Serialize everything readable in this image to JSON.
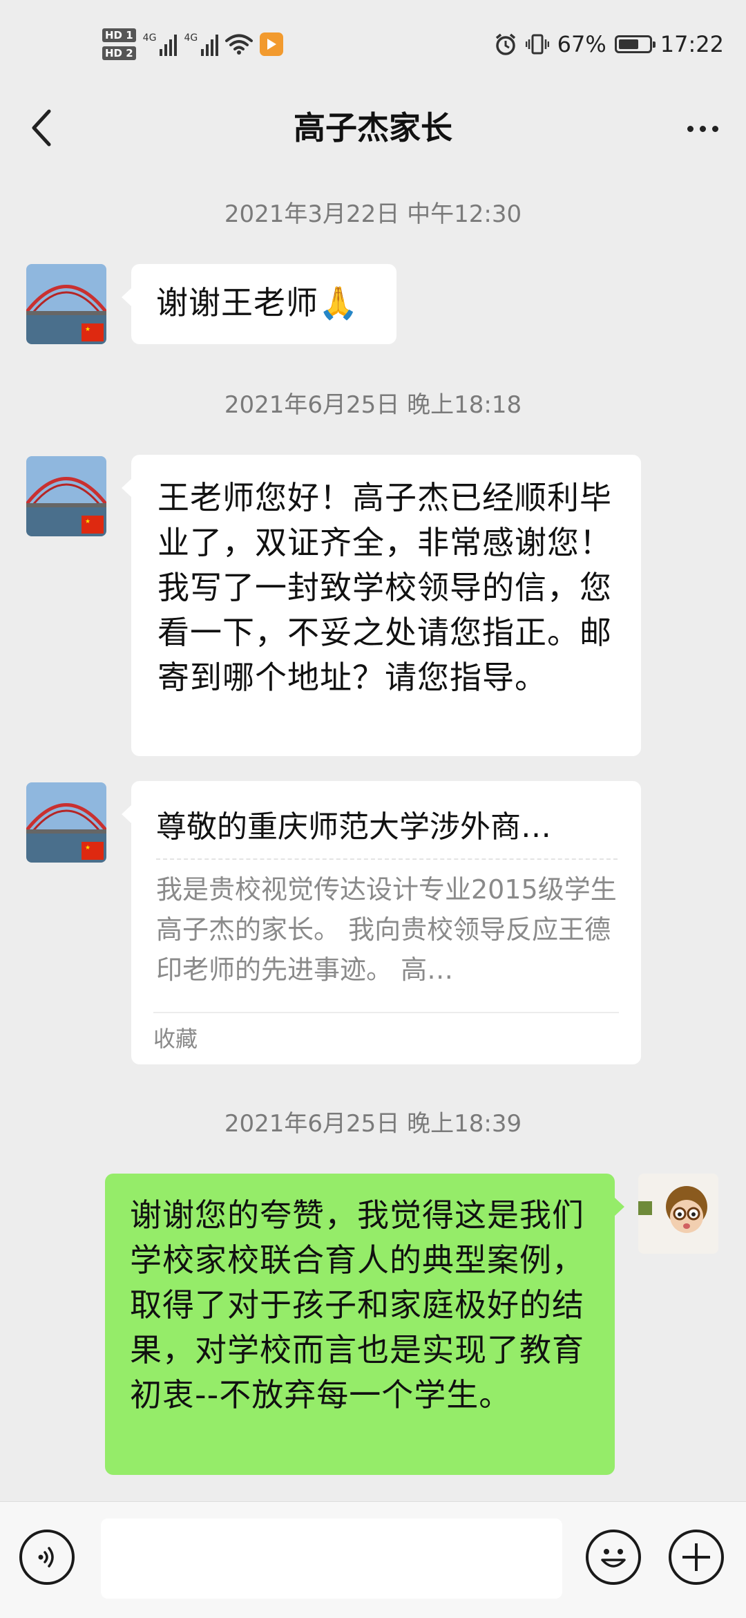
{
  "status_bar": {
    "hd1": "HD 1",
    "hd2": "HD 2",
    "sim1_label": "4G",
    "sim2_label": "4G",
    "battery_percent": "67%",
    "battery_level": 0.67,
    "time": "17:22"
  },
  "header": {
    "title": "高子杰家长",
    "back_icon": "chevron-left-icon",
    "more_icon": "more-dots-icon"
  },
  "messages": {
    "ts1": "2021年3月22日 中午12:30",
    "msg1": "谢谢王老师🙏",
    "ts2": "2021年6月25日 晚上18:18",
    "msg2": "王老师您好！高子杰已经顺利毕业了，双证齐全，非常感谢您！我写了一封致学校领导的信，您看一下，不妥之处请您指正。邮寄到哪个地址？请您指导。",
    "card": {
      "title": "尊敬的重庆师范大学涉外商…",
      "body": "我是贵校视觉传达设计专业2015级学生高子杰的家长。 我向贵校领导反应王德印老师的先进事迹。 高…",
      "footer": "收藏"
    },
    "ts3": "2021年6月25日 晚上18:39",
    "reply": "谢谢您的夸赞，我觉得这是我们学校家校联合育人的典型案例，取得了对于孩子和家庭极好的结果，对学校而言也是实现了教育初衷--不放弃每一个学生。"
  },
  "input_bar": {
    "voice_icon": "voice-icon",
    "emoji_icon": "emoji-icon",
    "plus_icon": "plus-icon",
    "placeholder": ""
  },
  "colors": {
    "background": "#ededed",
    "bubble_self": "#95ec69",
    "bubble_other": "#ffffff",
    "timestamp": "#7a7a7a"
  }
}
